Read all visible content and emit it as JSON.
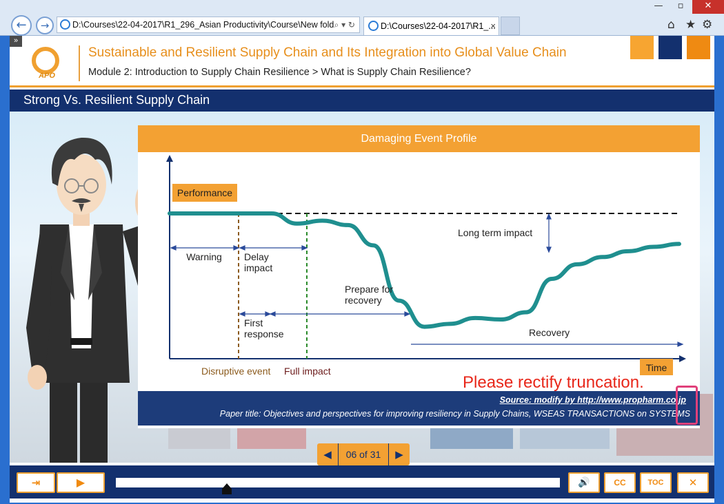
{
  "browser": {
    "address": "D:\\Courses\\22-04-2017\\R1_296_Asian Productivity\\Course\\New fold",
    "tab_title": "D:\\Courses\\22-04-2017\\R1_...",
    "address_tools": "⌕ ▾ ↻",
    "tab_close": "×",
    "icons": [
      "back-icon",
      "forward-icon",
      "home-icon",
      "star-icon",
      "gear-icon"
    ]
  },
  "header": {
    "logo_text": "APO",
    "course_title": "Sustainable and Resilient Supply Chain and Its Integration into Global Value Chain",
    "breadcrumb": "Module 2: Introduction to Supply Chain Resilience > What is Supply Chain Resilience?",
    "accent_colors": [
      "#f7a531",
      "#13306e",
      "#ef8a12"
    ]
  },
  "slide": {
    "title": "Strong Vs. Resilient Supply Chain",
    "panel_heading": "Damaging Event Profile"
  },
  "chart_data": {
    "type": "line",
    "title": "Damaging Event Profile",
    "ylabel": "Performance",
    "xlabel": "Time",
    "labels": {
      "warning": "Warning",
      "delay_impact": [
        "Delay",
        "impact"
      ],
      "first_response": [
        "First",
        "response"
      ],
      "prepare_for_recovery": [
        "Prepare for",
        "recovery"
      ],
      "long_term_impact": "Long term impact",
      "recovery": "Recovery",
      "disruptive_event": "Disruptive event",
      "full_impact": "Full impact"
    },
    "note": "Qualitative performance curve: flat until disruptive event, small dip, steep drop after full impact, trough, gradual recovery below original level",
    "series": [
      {
        "x": [
          0,
          10,
          20,
          25,
          30,
          35,
          40,
          45,
          50,
          55,
          60,
          65,
          70,
          75,
          80,
          85,
          90,
          95,
          100
        ],
        "y": [
          100,
          100,
          100,
          93,
          95,
          92,
          78,
          40,
          22,
          24,
          28,
          27,
          32,
          55,
          65,
          70,
          74,
          77,
          79
        ]
      }
    ],
    "baseline": 100
  },
  "annotation": {
    "message": "Please rectify truncation."
  },
  "source": {
    "source_line": "Source: modify by http://www.propharm.co.jp",
    "paper_line": "Paper title: Objectives and perspectives for improving resiliency in Supply Chains, WSEAS TRANSACTIONS on SYSTEMS"
  },
  "pager": {
    "prev": "◀",
    "text": "06 of 31",
    "next": "▶"
  },
  "controls": {
    "exit": "⇥",
    "play": "▶",
    "volume": "🔊",
    "cc": "CC",
    "toc": "TOC",
    "close": "✕",
    "progress": 0.25
  }
}
